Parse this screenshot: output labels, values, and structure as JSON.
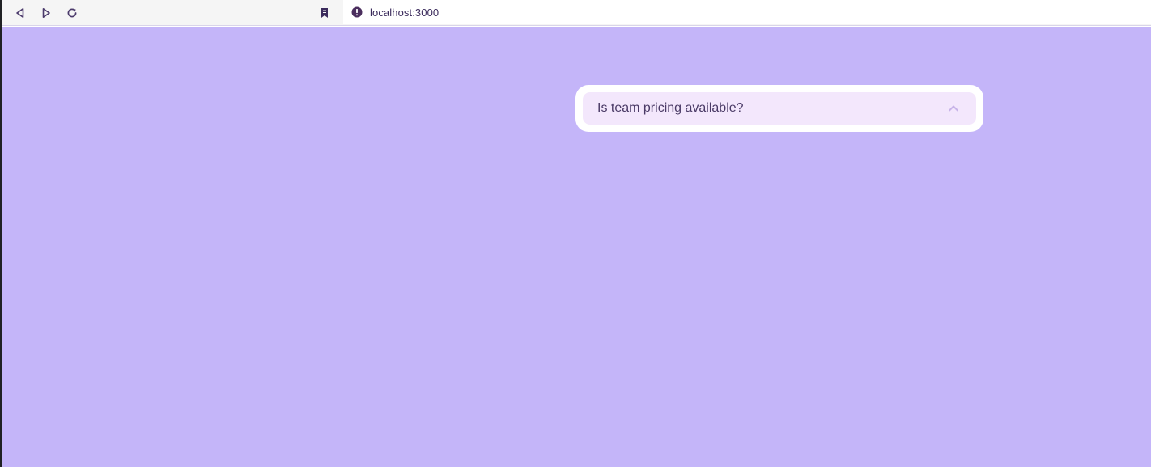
{
  "browser": {
    "url": "localhost:3000",
    "icons": {
      "back": "back-arrow-icon",
      "forward": "forward-arrow-icon",
      "reload": "reload-icon",
      "bookmark": "bookmark-icon",
      "site_info": "not-secure-icon"
    }
  },
  "page": {
    "background_color": "#c4b5f9",
    "faq": {
      "question": "Is team pricing available?",
      "toggle_icon": "chevron-up-icon",
      "accent_color": "#c7b3e8"
    }
  }
}
